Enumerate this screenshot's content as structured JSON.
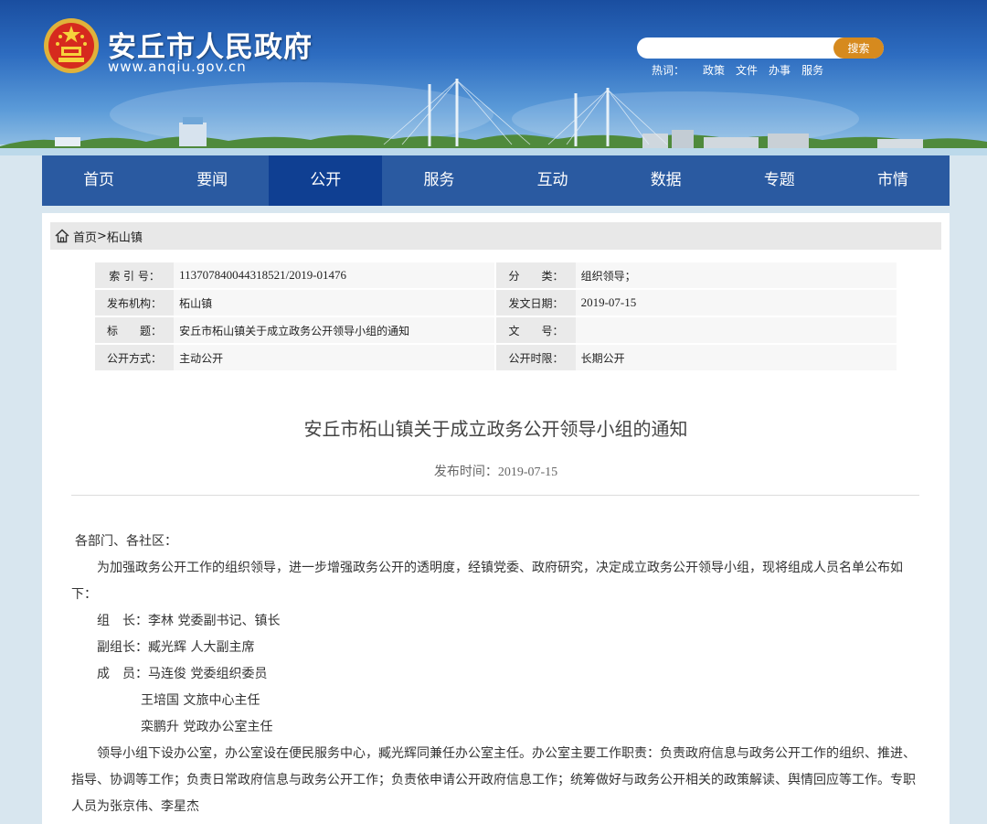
{
  "header": {
    "site_title": "安丘市人民政府",
    "site_url": "www.anqiu.gov.cn",
    "search_placeholder": "",
    "search_button": "搜索",
    "hot_label": "热词：",
    "hot_words": [
      "政策",
      "文件",
      "办事",
      "服务"
    ]
  },
  "nav": {
    "items": [
      "首页",
      "要闻",
      "公开",
      "服务",
      "互动",
      "数据",
      "专题",
      "市情"
    ],
    "active": "公开"
  },
  "breadcrumb": {
    "home": "首页",
    "separator": ">",
    "current": "柘山镇"
  },
  "info": {
    "index_label": "索 引 号：",
    "index_value": "113707840044318521/2019-01476",
    "category_label": "分　　类：",
    "category_value": "组织领导；",
    "publisher_label": "发布机构：",
    "publisher_value": "柘山镇",
    "issue_date_label": "发文日期：",
    "issue_date_value": "2019-07-15",
    "title_label": "标　　题：",
    "title_value": "安丘市柘山镇关于成立政务公开领导小组的通知",
    "doc_no_label": "文　　号：",
    "doc_no_value": "",
    "mode_label": "公开方式：",
    "mode_value": "主动公开",
    "period_label": "公开时限：",
    "period_value": "长期公开"
  },
  "article": {
    "title": "安丘市柘山镇关于成立政务公开领导小组的通知",
    "date_label": "发布时间：",
    "date_value": "2019-07-15",
    "greeting": "各部门、各社区：",
    "para1": "为加强政务公开工作的组织领导，进一步增强政务公开的透明度，经镇党委、政府研究，决定成立政务公开领导小组，现将组成人员名单公布如下：",
    "leader": "组　长：李林  党委副书记、镇长",
    "deputy": "副组长：臧光辉  人大副主席",
    "member1": "成　员：马连俊  党委组织委员",
    "member2": "王培国 文旅中心主任",
    "member3": "栾鹏升 党政办公室主任",
    "para2": "领导小组下设办公室，办公室设在便民服务中心，臧光辉同兼任办公室主任。办公室主要工作职责：负责政府信息与政务公开工作的组织、推进、指导、协调等工作；负责日常政府信息与政务公开工作；负责依申请公开政府信息工作；统筹做好与政务公开相关的政策解读、舆情回应等工作。专职人员为张京伟、李星杰"
  },
  "colors": {
    "nav_bg": "#2a5aa1",
    "nav_active": "#0f3f92",
    "search_button": "#d68a1e",
    "page_bg": "#d8e6ef"
  }
}
